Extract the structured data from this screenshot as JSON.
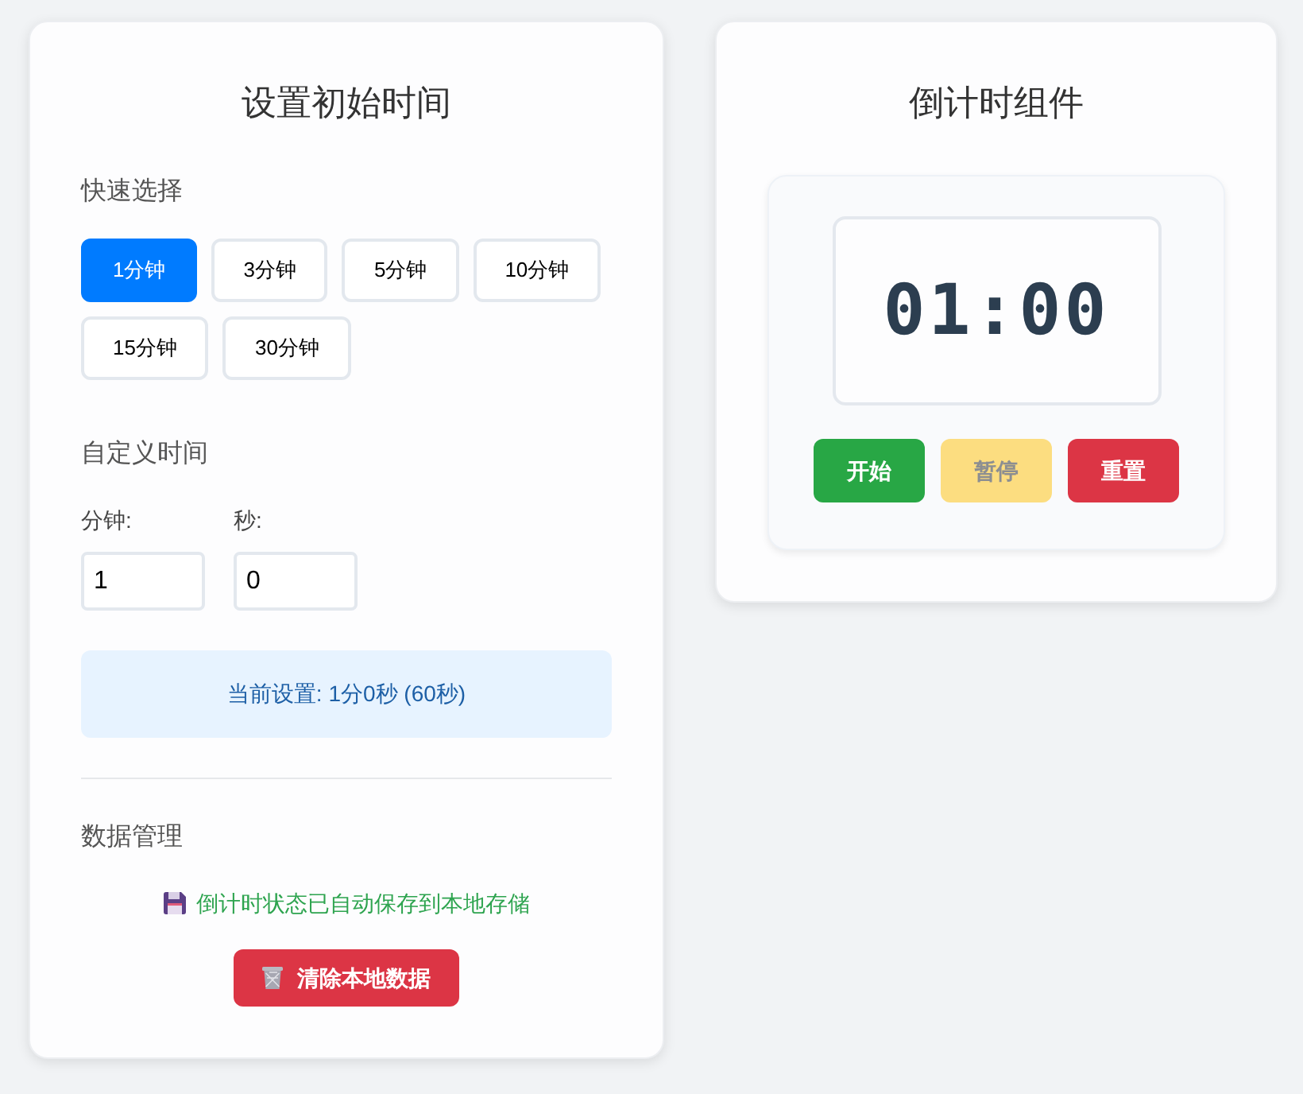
{
  "settings_panel": {
    "title": "设置初始时间",
    "quick_select": {
      "label": "快速选择",
      "options": [
        {
          "label": "1分钟",
          "selected": true
        },
        {
          "label": "3分钟",
          "selected": false
        },
        {
          "label": "5分钟",
          "selected": false
        },
        {
          "label": "10分钟",
          "selected": false
        },
        {
          "label": "15分钟",
          "selected": false
        },
        {
          "label": "30分钟",
          "selected": false
        }
      ]
    },
    "custom_time": {
      "label": "自定义时间",
      "minutes": {
        "label": "分钟:",
        "value": "1"
      },
      "seconds": {
        "label": "秒:",
        "value": "0"
      }
    },
    "current_setting": "当前设置: 1分0秒 (60秒)",
    "data_management": {
      "label": "数据管理",
      "status": "倒计时状态已自动保存到本地存储",
      "clear_button": "清除本地数据"
    }
  },
  "timer_panel": {
    "title": "倒计时组件",
    "display": "01:00",
    "buttons": [
      {
        "label": "开始",
        "kind": "start",
        "disabled": false
      },
      {
        "label": "暂停",
        "kind": "pause",
        "disabled": true
      },
      {
        "label": "重置",
        "kind": "reset",
        "disabled": false
      }
    ]
  }
}
